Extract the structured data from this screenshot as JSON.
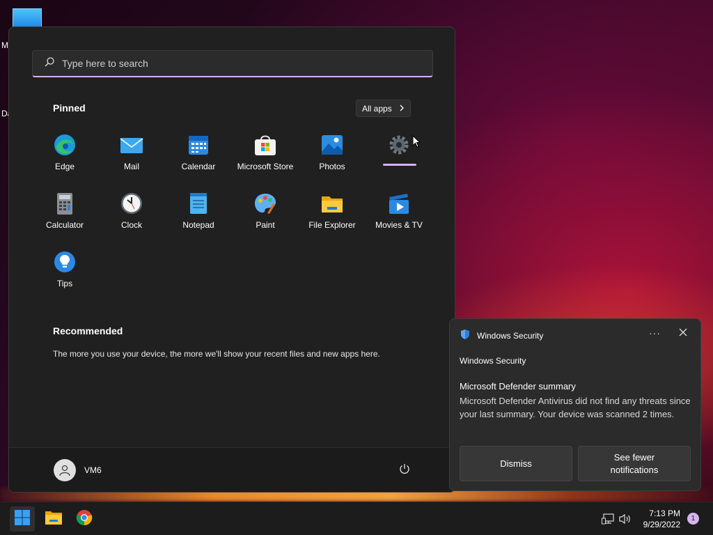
{
  "desktop": {
    "labels": [
      "M",
      "Da"
    ]
  },
  "start_menu": {
    "search_placeholder": "Type here to search",
    "pinned_title": "Pinned",
    "all_apps_label": "All apps",
    "pinned_apps": [
      {
        "label": "Edge",
        "icon": "edge-icon"
      },
      {
        "label": "Mail",
        "icon": "mail-icon"
      },
      {
        "label": "Calendar",
        "icon": "calendar-icon"
      },
      {
        "label": "Microsoft Store",
        "icon": "store-icon"
      },
      {
        "label": "Photos",
        "icon": "photos-icon"
      },
      {
        "label": "",
        "icon": "settings-icon"
      },
      {
        "label": "Calculator",
        "icon": "calculator-icon"
      },
      {
        "label": "Clock",
        "icon": "clock-icon"
      },
      {
        "label": "Notepad",
        "icon": "notepad-icon"
      },
      {
        "label": "Paint",
        "icon": "paint-icon"
      },
      {
        "label": "File Explorer",
        "icon": "folder-icon"
      },
      {
        "label": "Movies & TV",
        "icon": "movies-icon"
      },
      {
        "label": "Tips",
        "icon": "tips-icon"
      }
    ],
    "recommended_title": "Recommended",
    "recommended_text": "The more you use your device, the more we'll show your recent files and new apps here.",
    "user_name": "VM6"
  },
  "notification": {
    "app_name": "Windows Security",
    "more_label": "···",
    "subtitle": "Windows Security",
    "title": "Microsoft Defender summary",
    "body": "Microsoft Defender Antivirus did not find any threats since your last summary. Your device was scanned 2 times.",
    "dismiss_label": "Dismiss",
    "fewer_label": "See fewer notifications"
  },
  "taskbar": {
    "time": "7:13 PM",
    "date": "9/29/2022",
    "notification_count": "1"
  },
  "colors": {
    "accent": "#d6b4ec",
    "menu_bg": "#202020",
    "taskbar_bg": "#1c1c1c"
  }
}
